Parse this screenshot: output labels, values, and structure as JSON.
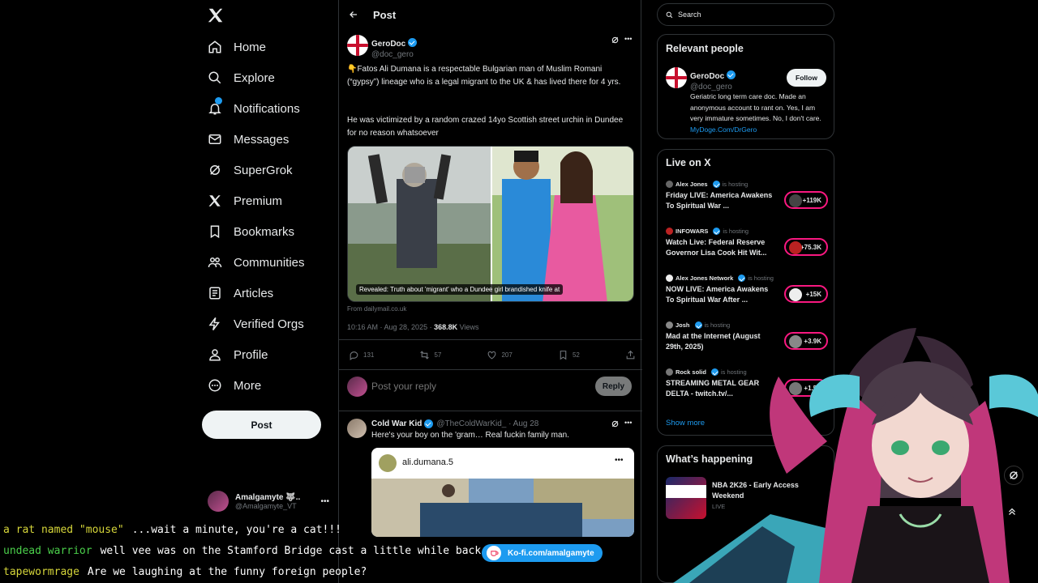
{
  "nav": {
    "items": [
      {
        "label": "Home",
        "icon": "home-icon"
      },
      {
        "label": "Explore",
        "icon": "search-icon"
      },
      {
        "label": "Notifications",
        "icon": "bell-icon"
      },
      {
        "label": "Messages",
        "icon": "mail-icon"
      },
      {
        "label": "SuperGrok",
        "icon": "grok-icon"
      },
      {
        "label": "Premium",
        "icon": "x-icon"
      },
      {
        "label": "Bookmarks",
        "icon": "bookmark-icon"
      },
      {
        "label": "Communities",
        "icon": "people-icon"
      },
      {
        "label": "Articles",
        "icon": "articles-icon"
      },
      {
        "label": "Verified Orgs",
        "icon": "lightning-icon"
      },
      {
        "label": "Profile",
        "icon": "person-icon"
      },
      {
        "label": "More",
        "icon": "more-icon"
      }
    ],
    "post_label": "Post",
    "account": {
      "name": "Amalgamyte 🐺..",
      "handle": "@Amalgamyte_VT"
    }
  },
  "header": {
    "title": "Post"
  },
  "post": {
    "name": "GeroDoc",
    "handle": "@doc_gero",
    "text1": "👇Fatos Ali Dumana is a respectable Bulgarian man of Muslim Romani (“gypsy”) lineage who is a legal migrant to the UK & has lived there for 4 yrs.",
    "text2": "He was victimized by a random crazed 14yo Scottish street urchin in Dundee for no reason whatsoever",
    "media_caption": "Revealed: Truth about 'migrant' who a Dundee girl brandished knife at",
    "source": "From dailymail.co.uk",
    "time": "10:16 AM · Aug 28, 2025 · ",
    "views_count": "368.8K",
    "views_label": " Views",
    "replies": "131",
    "reposts": "57",
    "likes": "207",
    "bookmarks": "52"
  },
  "reply_box": {
    "placeholder": "Post your reply",
    "button": "Reply"
  },
  "reply": {
    "name": "Cold War Kid",
    "handle": "@TheColdWarKid_ · Aug 28",
    "text": "Here's your boy on the 'gram… Real fuckin family man.",
    "embed_name": "ali.dumana.5"
  },
  "search": {
    "placeholder": "Search"
  },
  "relevant": {
    "title": "Relevant people",
    "name": "GeroDoc",
    "handle": "@doc_gero",
    "follow": "Follow",
    "bio": "Geriatric long term care doc. Made an anonymous account to rant on. Yes, I am very immature sometimes. No, I don't care. ",
    "bio_link": "MyDoge.Com/DrGero"
  },
  "live": {
    "title": "Live on X",
    "hosting": "is hosting",
    "items": [
      {
        "host": "Alex Jones",
        "title": "Friday LIVE: America Awakens To Spiritual War ...",
        "count": "+119K"
      },
      {
        "host": "INFOWARS",
        "title": "Watch Live: Federal Reserve Governor Lisa Cook Hit Wit...",
        "count": "+75.3K"
      },
      {
        "host": "Alex Jones Network",
        "title": "NOW LIVE: America Awakens To Spiritual War After ...",
        "count": "+15K"
      },
      {
        "host": "Josh",
        "title": "Mad at the Internet (August 29th, 2025)",
        "count": "+3.9K"
      },
      {
        "host": "Rock solid",
        "title": "STREAMING METAL GEAR DELTA - twitch.tv/...",
        "count": "+1.5K"
      }
    ],
    "show_more": "Show more"
  },
  "happening": {
    "title": "What’s happening",
    "item_title": "NBA 2K26 - Early Access Weekend",
    "item_sub": "LIVE"
  },
  "chat": [
    {
      "user": "a rat named \"mouse\"",
      "msg": "...wait a minute, you're a cat!!!",
      "color": "#d6d63a"
    },
    {
      "user": "undead warrior",
      "msg": "well vee was on the Stamford Bridge cast a little while back",
      "color": "#4bd04b"
    },
    {
      "user": "tapewormrage",
      "msg": "Are we laughing at the funny foreign people?",
      "color": "#d6d63a"
    }
  ],
  "kofi": {
    "label": "Ko-fi.com/amalgamyte"
  },
  "colors": {
    "accent": "#1d9bf0",
    "live_ring": "#f91880"
  }
}
